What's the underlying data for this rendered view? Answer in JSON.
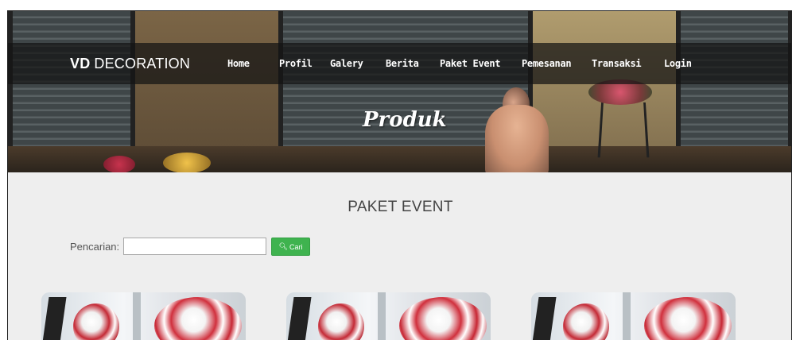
{
  "brand": {
    "bold": "VD",
    "light": "DECORATION"
  },
  "nav": {
    "items": [
      {
        "label": "Home"
      },
      {
        "label": "Profil"
      },
      {
        "label": "Galery"
      },
      {
        "label": "Berita"
      },
      {
        "label": "Paket Event"
      },
      {
        "label": "Pemesanan"
      },
      {
        "label": "Transaksi"
      },
      {
        "label": "Login"
      }
    ]
  },
  "hero": {
    "title": "Produk"
  },
  "main": {
    "section_title": "PAKET EVENT",
    "search": {
      "label": "Pencarian:",
      "value": "",
      "placeholder": "",
      "button_label": "Cari",
      "button_icon": "search-icon"
    },
    "cards_count_visible": 3
  },
  "colors": {
    "navbar_bg": "#141414",
    "accent_green": "#3fb34f",
    "page_bg": "#eeeeee"
  }
}
